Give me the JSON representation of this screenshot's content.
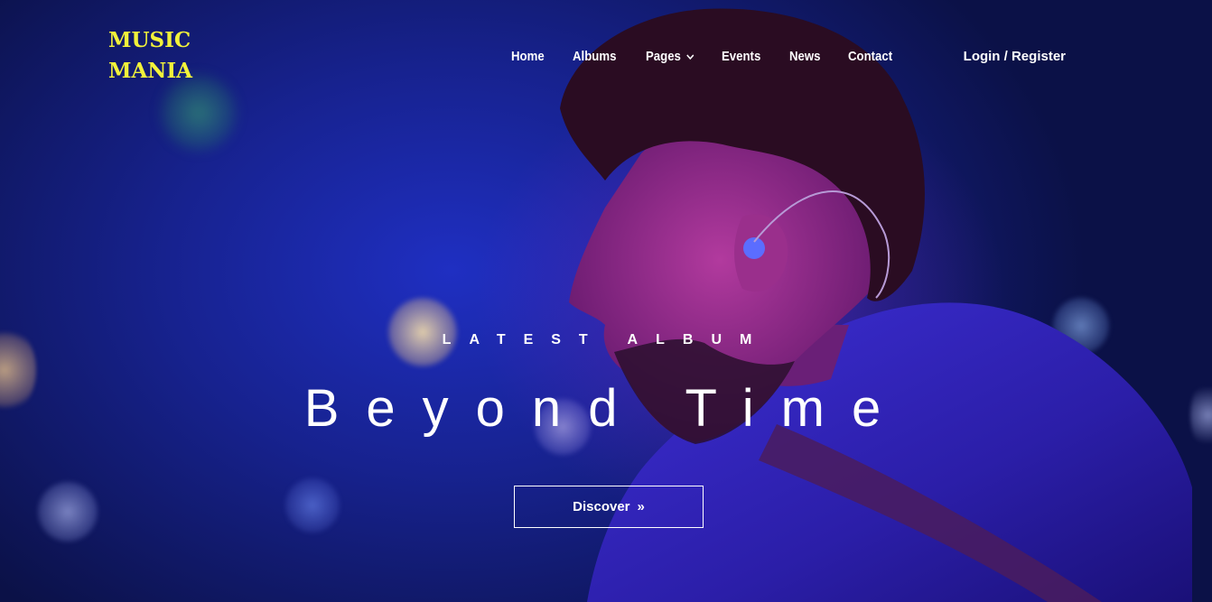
{
  "brand": {
    "line1": "MUSIC",
    "line2": "MANIA",
    "color": "#f2f23a"
  },
  "nav": {
    "items": [
      {
        "label": "Home"
      },
      {
        "label": "Albums"
      },
      {
        "label": "Pages",
        "has_dropdown": true,
        "icon": "chevron-down-icon"
      },
      {
        "label": "Events"
      },
      {
        "label": "News"
      },
      {
        "label": "Contact"
      }
    ],
    "login_label": "Login / Register"
  },
  "hero": {
    "kicker": "LATEST ALBUM",
    "title": "Beyond Time",
    "cta_label": "Discover",
    "cta_icon": "double-chevron-right-icon",
    "cta_glyph": "»",
    "background_image": "singer-on-stage-photo",
    "palette": {
      "deep_blue": "#17228f",
      "violet": "#6e28c8",
      "text": "#ffffff"
    }
  }
}
